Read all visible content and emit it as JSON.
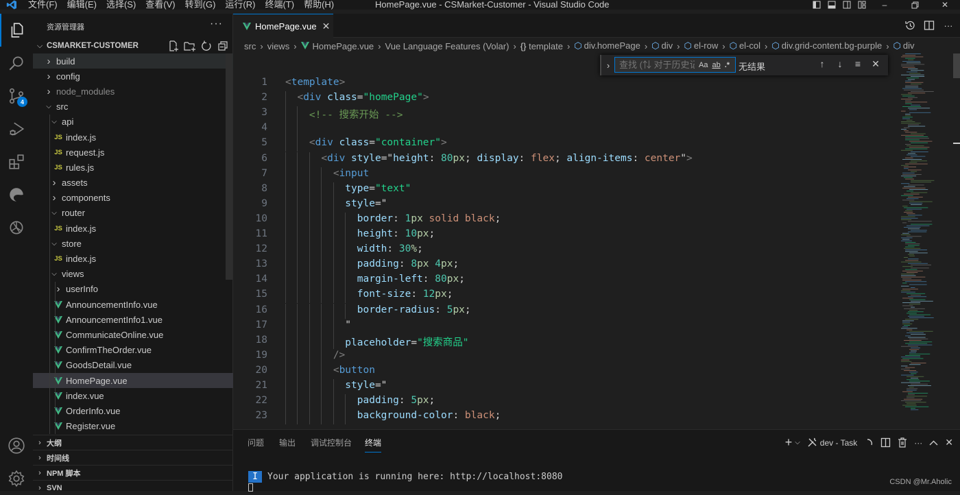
{
  "titlebar": {
    "menu": [
      "文件(F)",
      "编辑(E)",
      "选择(S)",
      "查看(V)",
      "转到(G)",
      "运行(R)",
      "终端(T)",
      "帮助(H)"
    ],
    "title": "HomePage.vue - CSMarket-Customer - Visual Studio Code",
    "minimize": "–",
    "close": "✕"
  },
  "activity_bar": {
    "items": [
      "explorer",
      "search",
      "source-control",
      "run-debug",
      "extensions",
      "edge-devtools",
      "chatgpt"
    ],
    "source_control_badge": "4",
    "bottom": [
      "accounts",
      "manage"
    ]
  },
  "sidebar": {
    "title": "资源管理器",
    "project": "CSMARKET-CUSTOMER",
    "tree": [
      {
        "label": "build",
        "type": "folder",
        "open": false,
        "depth": 0
      },
      {
        "label": "config",
        "type": "folder",
        "open": false,
        "depth": 0
      },
      {
        "label": "node_modules",
        "type": "folder",
        "open": false,
        "depth": 0,
        "dim": true
      },
      {
        "label": "src",
        "type": "folder",
        "open": true,
        "depth": 0
      },
      {
        "label": "api",
        "type": "folder",
        "open": true,
        "depth": 1
      },
      {
        "label": "index.js",
        "type": "js",
        "depth": 2
      },
      {
        "label": "request.js",
        "type": "js",
        "depth": 2
      },
      {
        "label": "rules.js",
        "type": "js",
        "depth": 2
      },
      {
        "label": "assets",
        "type": "folder",
        "open": false,
        "depth": 1
      },
      {
        "label": "components",
        "type": "folder",
        "open": false,
        "depth": 1
      },
      {
        "label": "router",
        "type": "folder",
        "open": true,
        "depth": 1
      },
      {
        "label": "index.js",
        "type": "js",
        "depth": 2
      },
      {
        "label": "store",
        "type": "folder",
        "open": true,
        "depth": 1
      },
      {
        "label": "index.js",
        "type": "js",
        "depth": 2
      },
      {
        "label": "views",
        "type": "folder",
        "open": true,
        "depth": 1
      },
      {
        "label": "userInfo",
        "type": "folder",
        "open": false,
        "depth": 2
      },
      {
        "label": "AnnouncementInfo.vue",
        "type": "vue",
        "depth": 2
      },
      {
        "label": "AnnouncementInfo1.vue",
        "type": "vue",
        "depth": 2
      },
      {
        "label": "CommunicateOnline.vue",
        "type": "vue",
        "depth": 2
      },
      {
        "label": "ConfirmTheOrder.vue",
        "type": "vue",
        "depth": 2
      },
      {
        "label": "GoodsDetail.vue",
        "type": "vue",
        "depth": 2
      },
      {
        "label": "HomePage.vue",
        "type": "vue",
        "depth": 2,
        "selected": true
      },
      {
        "label": "index.vue",
        "type": "vue",
        "depth": 2
      },
      {
        "label": "OrderInfo.vue",
        "type": "vue",
        "depth": 2
      },
      {
        "label": "Register.vue",
        "type": "vue",
        "depth": 2
      }
    ],
    "panels": [
      "大纲",
      "时间线",
      "NPM 脚本",
      "SVN"
    ],
    "js_icon_text": "JS"
  },
  "editor": {
    "tab": {
      "label": "HomePage.vue",
      "close": "✕"
    },
    "breadcrumbs": [
      "src",
      "views",
      "HomePage.vue",
      "Vue Language Features (Volar)",
      "template",
      "div.homePage",
      "div",
      "el-row",
      "el-col",
      "div.grid-content.bg-purple",
      "div"
    ],
    "find": {
      "placeholder": "查找 (⇅ 对于历史记录)",
      "match_case": "Aa",
      "whole_word": "ab",
      "regex": ".*",
      "result": "无结果"
    },
    "lines": [
      {
        "n": "1",
        "indent": 0,
        "tokens": [
          [
            "t-punc",
            "<"
          ],
          [
            "t-tag",
            "template"
          ],
          [
            "t-punc",
            ">"
          ]
        ]
      },
      {
        "n": "2",
        "indent": 1,
        "tokens": [
          [
            "t-punc",
            "<"
          ],
          [
            "t-tag",
            "div"
          ],
          [
            "t-plain",
            " "
          ],
          [
            "t-attr",
            "class"
          ],
          [
            "t-plain",
            "="
          ],
          [
            "t-strg",
            "\"homePage\""
          ],
          [
            "t-punc",
            ">"
          ]
        ]
      },
      {
        "n": "3",
        "indent": 2,
        "tokens": [
          [
            "t-com",
            "<!-- 搜索开始 -->"
          ]
        ]
      },
      {
        "n": "4",
        "indent": 2,
        "tokens": []
      },
      {
        "n": "5",
        "indent": 2,
        "tokens": [
          [
            "t-punc",
            "<"
          ],
          [
            "t-tag",
            "div"
          ],
          [
            "t-plain",
            " "
          ],
          [
            "t-attr",
            "class"
          ],
          [
            "t-plain",
            "="
          ],
          [
            "t-strg",
            "\"container\""
          ],
          [
            "t-punc",
            ">"
          ]
        ]
      },
      {
        "n": "6",
        "indent": 3,
        "tokens": [
          [
            "t-punc",
            "<"
          ],
          [
            "t-tag",
            "div"
          ],
          [
            "t-plain",
            " "
          ],
          [
            "t-attr",
            "style"
          ],
          [
            "t-plain",
            "=\""
          ],
          [
            "t-prop",
            "height"
          ],
          [
            "t-plain",
            ": "
          ],
          [
            "t-num",
            "80"
          ],
          [
            "t-unit",
            "px"
          ],
          [
            "t-plain",
            "; "
          ],
          [
            "t-prop",
            "display"
          ],
          [
            "t-plain",
            ": "
          ],
          [
            "t-val",
            "flex"
          ],
          [
            "t-plain",
            "; "
          ],
          [
            "t-prop",
            "align-items"
          ],
          [
            "t-plain",
            ": "
          ],
          [
            "t-val",
            "center"
          ],
          [
            "t-plain",
            "\""
          ],
          [
            "t-punc",
            ">"
          ]
        ]
      },
      {
        "n": "7",
        "indent": 4,
        "tokens": [
          [
            "t-punc",
            "<"
          ],
          [
            "t-tag",
            "input"
          ]
        ]
      },
      {
        "n": "8",
        "indent": 5,
        "tokens": [
          [
            "t-attr",
            "type"
          ],
          [
            "t-plain",
            "="
          ],
          [
            "t-strg",
            "\"text\""
          ]
        ]
      },
      {
        "n": "9",
        "indent": 5,
        "tokens": [
          [
            "t-attr",
            "style"
          ],
          [
            "t-plain",
            "=\""
          ]
        ]
      },
      {
        "n": "10",
        "indent": 6,
        "tokens": [
          [
            "t-prop",
            "border"
          ],
          [
            "t-plain",
            ": "
          ],
          [
            "t-num",
            "1"
          ],
          [
            "t-unit",
            "px"
          ],
          [
            "t-plain",
            " "
          ],
          [
            "t-val",
            "solid black"
          ],
          [
            "t-plain",
            ";"
          ]
        ]
      },
      {
        "n": "11",
        "indent": 6,
        "tokens": [
          [
            "t-prop",
            "height"
          ],
          [
            "t-plain",
            ": "
          ],
          [
            "t-num",
            "10"
          ],
          [
            "t-unit",
            "px"
          ],
          [
            "t-plain",
            ";"
          ]
        ]
      },
      {
        "n": "12",
        "indent": 6,
        "tokens": [
          [
            "t-prop",
            "width"
          ],
          [
            "t-plain",
            ": "
          ],
          [
            "t-num",
            "30"
          ],
          [
            "t-unit",
            "%"
          ],
          [
            "t-plain",
            ";"
          ]
        ]
      },
      {
        "n": "13",
        "indent": 6,
        "tokens": [
          [
            "t-prop",
            "padding"
          ],
          [
            "t-plain",
            ": "
          ],
          [
            "t-num",
            "8"
          ],
          [
            "t-unit",
            "px"
          ],
          [
            "t-plain",
            " "
          ],
          [
            "t-num",
            "4"
          ],
          [
            "t-unit",
            "px"
          ],
          [
            "t-plain",
            ";"
          ]
        ]
      },
      {
        "n": "14",
        "indent": 6,
        "tokens": [
          [
            "t-prop",
            "margin-left"
          ],
          [
            "t-plain",
            ": "
          ],
          [
            "t-num",
            "80"
          ],
          [
            "t-unit",
            "px"
          ],
          [
            "t-plain",
            ";"
          ]
        ]
      },
      {
        "n": "15",
        "indent": 6,
        "tokens": [
          [
            "t-prop",
            "font-size"
          ],
          [
            "t-plain",
            ": "
          ],
          [
            "t-num",
            "12"
          ],
          [
            "t-unit",
            "px"
          ],
          [
            "t-plain",
            ";"
          ]
        ]
      },
      {
        "n": "16",
        "indent": 6,
        "tokens": [
          [
            "t-prop",
            "border-radius"
          ],
          [
            "t-plain",
            ": "
          ],
          [
            "t-num",
            "5"
          ],
          [
            "t-unit",
            "px"
          ],
          [
            "t-plain",
            ";"
          ]
        ]
      },
      {
        "n": "17",
        "indent": 5,
        "tokens": [
          [
            "t-plain",
            "\""
          ]
        ]
      },
      {
        "n": "18",
        "indent": 5,
        "tokens": [
          [
            "t-attr",
            "placeholder"
          ],
          [
            "t-plain",
            "="
          ],
          [
            "t-strg",
            "\"搜索商品\""
          ]
        ]
      },
      {
        "n": "19",
        "indent": 4,
        "tokens": [
          [
            "t-punc",
            "/>"
          ]
        ]
      },
      {
        "n": "20",
        "indent": 4,
        "tokens": [
          [
            "t-punc",
            "<"
          ],
          [
            "t-tag",
            "button"
          ]
        ]
      },
      {
        "n": "21",
        "indent": 5,
        "tokens": [
          [
            "t-attr",
            "style"
          ],
          [
            "t-plain",
            "=\""
          ]
        ]
      },
      {
        "n": "22",
        "indent": 6,
        "tokens": [
          [
            "t-prop",
            "padding"
          ],
          [
            "t-plain",
            ": "
          ],
          [
            "t-num",
            "5"
          ],
          [
            "t-unit",
            "px"
          ],
          [
            "t-plain",
            ";"
          ]
        ]
      },
      {
        "n": "23",
        "indent": 6,
        "tokens": [
          [
            "t-prop",
            "background-color"
          ],
          [
            "t-plain",
            ": "
          ],
          [
            "t-val",
            "black"
          ],
          [
            "t-plain",
            ";"
          ]
        ]
      }
    ]
  },
  "panel": {
    "tabs": [
      "问题",
      "输出",
      "调试控制台",
      "终端"
    ],
    "active_tab": "终端",
    "task_label": "dev - Task",
    "terminal_badge": "I",
    "terminal_line": "Your application is running here: http://localhost:8080",
    "watermark": "CSDN @Mr.Aholic"
  },
  "colors": {
    "accent": "#0078d4",
    "vue_green": "#41b883",
    "js_yellow": "#cbcb41",
    "selection": "#37373d"
  }
}
